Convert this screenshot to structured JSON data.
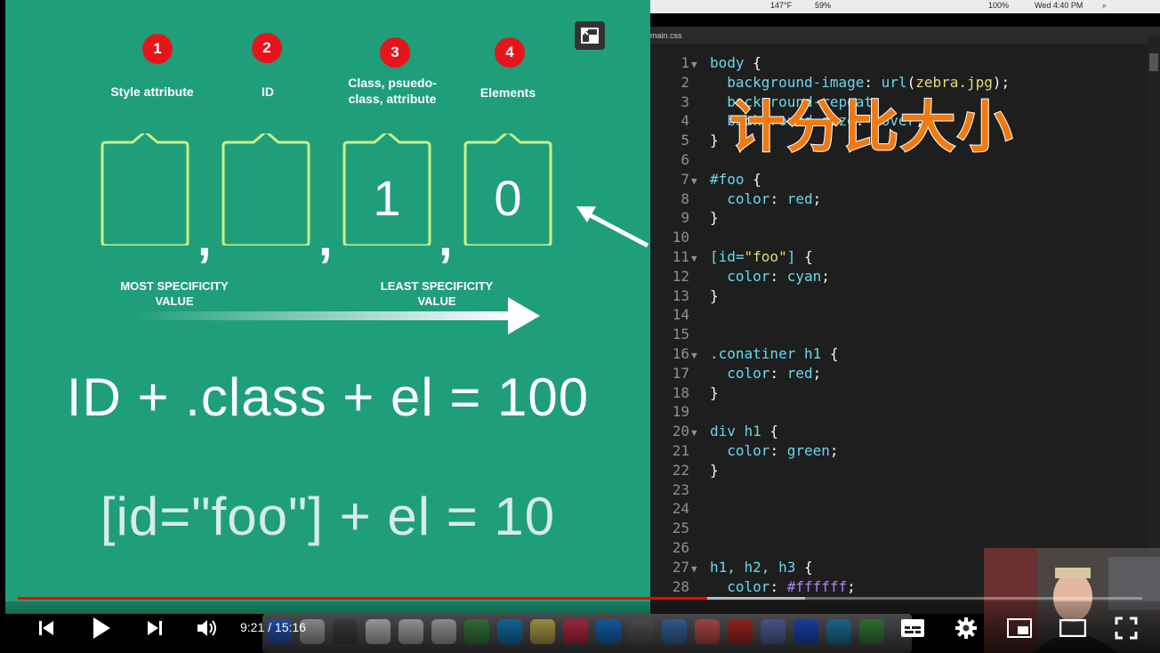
{
  "slide": {
    "columns": [
      {
        "number": "1",
        "label": "Style attribute",
        "digit": ""
      },
      {
        "number": "2",
        "label": "ID",
        "digit": ""
      },
      {
        "number": "3",
        "label": "Class, psuedo-\nclass, attribute",
        "digit": "1"
      },
      {
        "number": "4",
        "label": "Elements",
        "digit": "0"
      }
    ],
    "most_specificity": "MOST SPECIFICITY\nVALUE",
    "least_specificity": "LEAST SPECIFICITY\nVALUE",
    "formula1": "ID + .class + el = 100",
    "formula2": "[id=\"foo\"] + el = 10",
    "exit_pip_icon": "exit-fullscreen-icon"
  },
  "menubar": {
    "weather": "147°F",
    "mem": "59%",
    "battery": "100%",
    "clock": "Wed 4:40 PM"
  },
  "editor": {
    "tab": "main.css",
    "caption": "计分比大小",
    "lines": [
      {
        "n": "1",
        "fold": "▼",
        "t": "body {"
      },
      {
        "n": "2",
        "fold": "",
        "t": "  background-image: url(zebra.jpg);"
      },
      {
        "n": "3",
        "fold": "",
        "t": "  background-repeat:"
      },
      {
        "n": "4",
        "fold": "",
        "t": "  background-size: cover;"
      },
      {
        "n": "5",
        "fold": "",
        "t": "}"
      },
      {
        "n": "6",
        "fold": "",
        "t": ""
      },
      {
        "n": "7",
        "fold": "▼",
        "t": "#foo {"
      },
      {
        "n": "8",
        "fold": "",
        "t": "  color: red;"
      },
      {
        "n": "9",
        "fold": "",
        "t": "}"
      },
      {
        "n": "10",
        "fold": "",
        "t": ""
      },
      {
        "n": "11",
        "fold": "▼",
        "t": "[id=\"foo\"] {"
      },
      {
        "n": "12",
        "fold": "",
        "t": "  color: cyan;"
      },
      {
        "n": "13",
        "fold": "",
        "t": "}"
      },
      {
        "n": "14",
        "fold": "",
        "t": ""
      },
      {
        "n": "15",
        "fold": "",
        "t": ""
      },
      {
        "n": "16",
        "fold": "▼",
        "t": ".conatiner h1 {"
      },
      {
        "n": "17",
        "fold": "",
        "t": "  color: red;"
      },
      {
        "n": "18",
        "fold": "",
        "t": "}"
      },
      {
        "n": "19",
        "fold": "",
        "t": ""
      },
      {
        "n": "20",
        "fold": "▼",
        "t": "div h1 {"
      },
      {
        "n": "21",
        "fold": "",
        "t": "  color: green;"
      },
      {
        "n": "22",
        "fold": "",
        "t": "}"
      },
      {
        "n": "23",
        "fold": "",
        "t": ""
      },
      {
        "n": "24",
        "fold": "",
        "t": ""
      },
      {
        "n": "25",
        "fold": "",
        "t": ""
      },
      {
        "n": "26",
        "fold": "",
        "t": ""
      },
      {
        "n": "27",
        "fold": "▼",
        "t": "h1, h2, h3 {"
      },
      {
        "n": "28",
        "fold": "",
        "t": "  color: #ffffff;"
      }
    ]
  },
  "player": {
    "time": "9:21 / 15:16",
    "progress": 0.613,
    "buffered": 0.7,
    "colors": {
      "progress": "#ff0000",
      "slide": "#1f9e7a",
      "accent": "#e8141b"
    }
  }
}
